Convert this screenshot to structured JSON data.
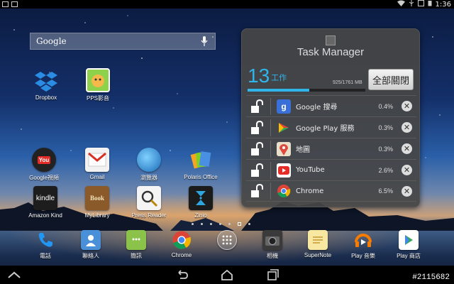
{
  "status_bar": {
    "time": "1:36"
  },
  "search": {
    "logo_text": "Google"
  },
  "desktop_apps": [
    {
      "label": "Dropbox",
      "icon": "dropbox-icon"
    },
    {
      "label": "PPS影音",
      "icon": "pps-icon"
    },
    {
      "label": "Google視頻",
      "icon": "youtube-icon"
    },
    {
      "label": "Gmail",
      "icon": "gmail-icon"
    },
    {
      "label": "瀏覽器",
      "icon": "browser-globe-icon"
    },
    {
      "label": "Polaris Office",
      "icon": "polaris-office-icon"
    },
    {
      "label": "Amazon Kind",
      "icon": "kindle-icon",
      "icon_text": "kindle"
    },
    {
      "label": "MyLibrary",
      "icon": "book-icon",
      "icon_text": "Book"
    },
    {
      "label": "Press Reader",
      "icon": "magnifier-icon"
    },
    {
      "label": "Zinio",
      "icon": "zinio-icon"
    }
  ],
  "task_manager": {
    "title": "Task Manager",
    "count": "13",
    "count_unit": "工作",
    "memory": "925/1761 MB",
    "memory_used_fraction": 0.525,
    "close_all_label": "全部關閉",
    "apps": [
      {
        "name": "Google 搜尋",
        "percent": "0.4%",
        "icon": "google-search-icon"
      },
      {
        "name": "Google Play 服務",
        "percent": "0.3%",
        "icon": "play-services-icon"
      },
      {
        "name": "地圖",
        "percent": "0.3%",
        "icon": "maps-icon"
      },
      {
        "name": "YouTube",
        "percent": "2.6%",
        "icon": "youtube-icon"
      },
      {
        "name": "Chrome",
        "percent": "6.5%",
        "icon": "chrome-icon"
      }
    ]
  },
  "dock": [
    {
      "label": "電話",
      "icon": "phone-icon"
    },
    {
      "label": "聯絡人",
      "icon": "contacts-icon"
    },
    {
      "label": "簡訊",
      "icon": "messaging-icon"
    },
    {
      "label": "Chrome",
      "icon": "chrome-icon"
    },
    {
      "label": "",
      "icon": "app-drawer-icon"
    },
    {
      "label": "相機",
      "icon": "camera-icon"
    },
    {
      "label": "SuperNote",
      "icon": "supernote-icon"
    },
    {
      "label": "Play 音樂",
      "icon": "play-music-icon"
    },
    {
      "label": "Play 商店",
      "icon": "play-store-icon"
    }
  ],
  "watermark": "#2115682",
  "colors": {
    "accent": "#2fb5ea"
  }
}
